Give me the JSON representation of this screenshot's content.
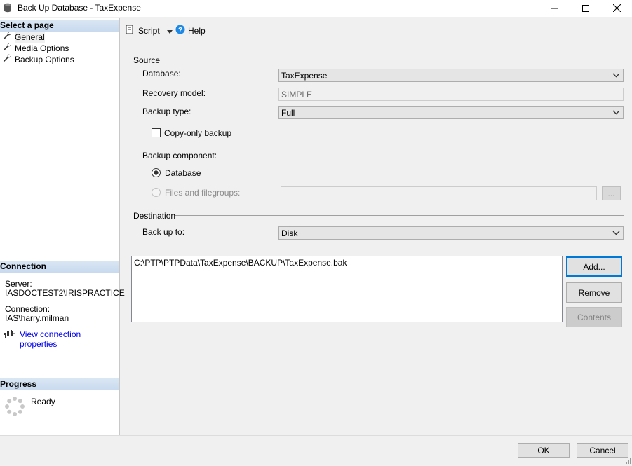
{
  "window": {
    "title": "Back Up Database - TaxExpense",
    "icons": {
      "app": "database-icon",
      "minimize": "minimize-icon",
      "maximize": "maximize-icon",
      "close": "close-icon"
    }
  },
  "left_panel": {
    "select_page_header": "Select a page",
    "pages": [
      {
        "label": "General",
        "icon": "wrench-icon"
      },
      {
        "label": "Media Options",
        "icon": "wrench-icon"
      },
      {
        "label": "Backup Options",
        "icon": "wrench-icon"
      }
    ],
    "connection": {
      "header": "Connection",
      "server_label": "Server:",
      "server_value": "IASDOCTEST2\\IRISPRACTICE",
      "connection_label": "Connection:",
      "connection_value": "IAS\\harry.milman",
      "view_link": "View connection properties"
    },
    "progress": {
      "header": "Progress",
      "status": "Ready"
    }
  },
  "toolbar": {
    "script_label": "Script",
    "help_label": "Help"
  },
  "source": {
    "section_label": "Source",
    "database_label": "Database:",
    "database_value": "TaxExpense",
    "recovery_label": "Recovery model:",
    "recovery_value": "SIMPLE",
    "backup_type_label": "Backup type:",
    "backup_type_value": "Full",
    "copy_only_label": "Copy-only backup",
    "copy_only_checked": false,
    "component_label": "Backup component:",
    "component_database_label": "Database",
    "component_files_label": "Files and filegroups:",
    "component_selected": "Database",
    "ellipsis_label": "..."
  },
  "destination": {
    "section_label": "Destination",
    "backup_to_label": "Back up to:",
    "backup_to_value": "Disk",
    "paths": [
      "C:\\PTP\\PTPData\\TaxExpense\\BACKUP\\TaxExpense.bak"
    ],
    "add_label": "Add...",
    "remove_label": "Remove",
    "contents_label": "Contents"
  },
  "footer": {
    "ok_label": "OK",
    "cancel_label": "Cancel"
  },
  "colors": {
    "accent": "#0078d7",
    "header_gradient": "#c9daef",
    "link": "#0000ee",
    "help_icon": "#1e88e5"
  }
}
